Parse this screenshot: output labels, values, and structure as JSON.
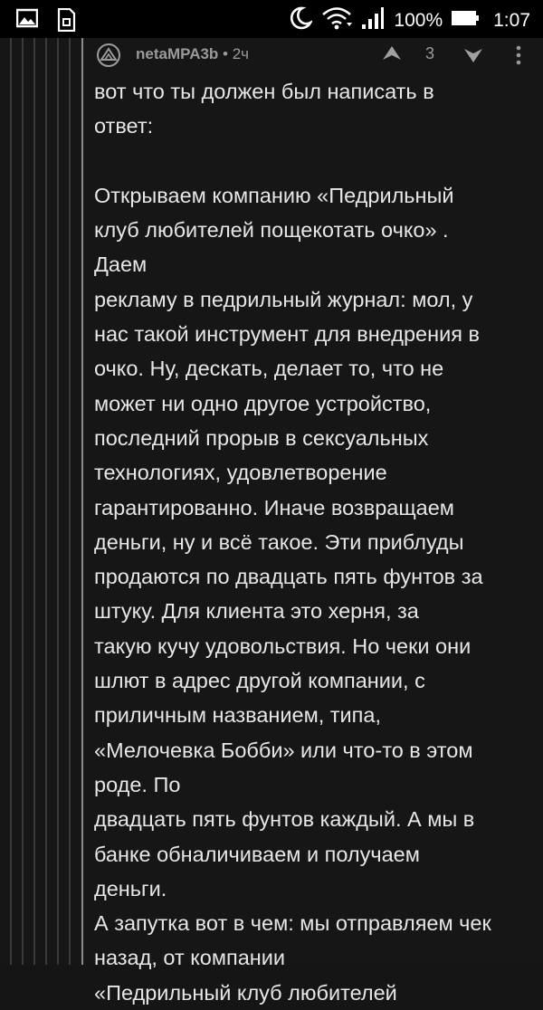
{
  "status_bar": {
    "icons": [
      "image-icon",
      "sim-card-icon",
      "do-not-disturb-moon-icon",
      "wifi-icon",
      "signal-icon",
      "battery-icon"
    ],
    "battery": "100%",
    "time": "1:07"
  },
  "comment": {
    "author": "netaMPA3b",
    "time": " • 2ч",
    "score": "3",
    "lines": [
      "вот что ты должен был написать в",
      "ответ:",
      "",
      "Открываем компанию «Педрильный",
      "клуб любителей пощекотать очко» .",
      "Даем",
      "рекламу в педрильный журнал: мол, у",
      "нас такой инструмент для внедрения в",
      "очко. Ну, дескать, делает то, что не",
      "может ни одно другое устройство,",
      "последний прорыв в сексуальных",
      "технологиях, удовлетворение",
      "гарантированно. Иначе возвращаем",
      "деньги, ну и всё такое. Эти приблуды",
      "продаются по двадцать пять фунтов за",
      "штуку. Для клиента это херня, за",
      "такую кучу удовольствия. Но чеки они",
      "шлют в адрес другой компании, с",
      "приличным названием, типа,",
      "«Мелочевка Бобби» или что-то в этом",
      "роде. По",
      "двадцать пять фунтов каждый. А мы в",
      "банке обналичиваем и получаем",
      "деньги.",
      "А запутка вот в чем: мы отправляем чек",
      "назад, от компании",
      "«Педрильный клуб любителей"
    ]
  }
}
